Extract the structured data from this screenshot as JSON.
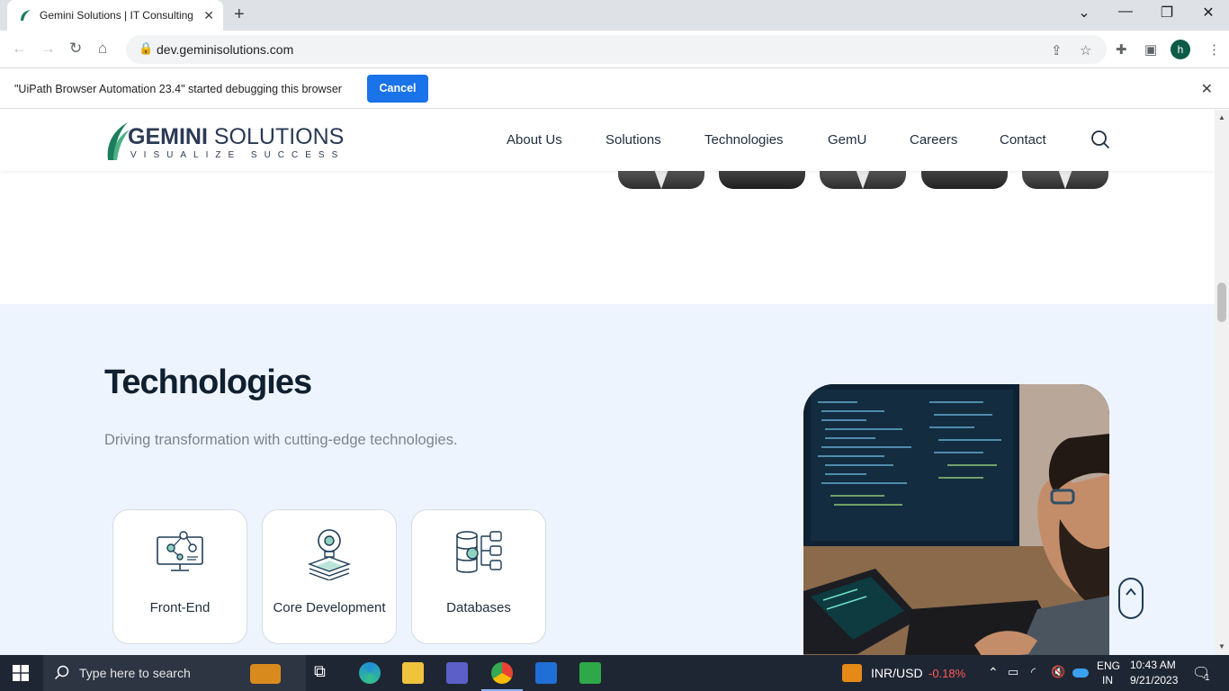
{
  "browser": {
    "tab_title": "Gemini Solutions | IT Consulting",
    "url": "dev.geminisolutions.com",
    "profile_initial": "h"
  },
  "infobar": {
    "message": "\"UiPath Browser Automation 23.4\" started debugging this browser",
    "cancel_label": "Cancel"
  },
  "site": {
    "logo_word_1": "GEMINI",
    "logo_word_2": "SOLUTIONS",
    "logo_tagline": "VISUALIZE SUCCESS",
    "nav": [
      "About Us",
      "Solutions",
      "Technologies",
      "GemU",
      "Careers",
      "Contact"
    ]
  },
  "technologies": {
    "title": "Technologies",
    "subtitle": "Driving transformation with cutting-edge technologies.",
    "cards": [
      {
        "label": "Front-End",
        "icon": "monitor-network-icon"
      },
      {
        "label": "Core Development",
        "icon": "lightbulb-gear-icon"
      },
      {
        "label": "Databases",
        "icon": "database-gear-icon"
      }
    ]
  },
  "taskbar": {
    "search_placeholder": "Type here to search",
    "ticker_label": "INR/USD",
    "ticker_change": "-0.18%",
    "lang_1": "ENG",
    "lang_2": "IN",
    "time": "10:43 AM",
    "date": "9/21/2023",
    "notification_count": "1"
  },
  "colors": {
    "accent_blue": "#1a73e8",
    "section_bg": "#eef4fd",
    "ticker_negative": "#ff5a5a",
    "brand_navy": "#2b3a55"
  }
}
